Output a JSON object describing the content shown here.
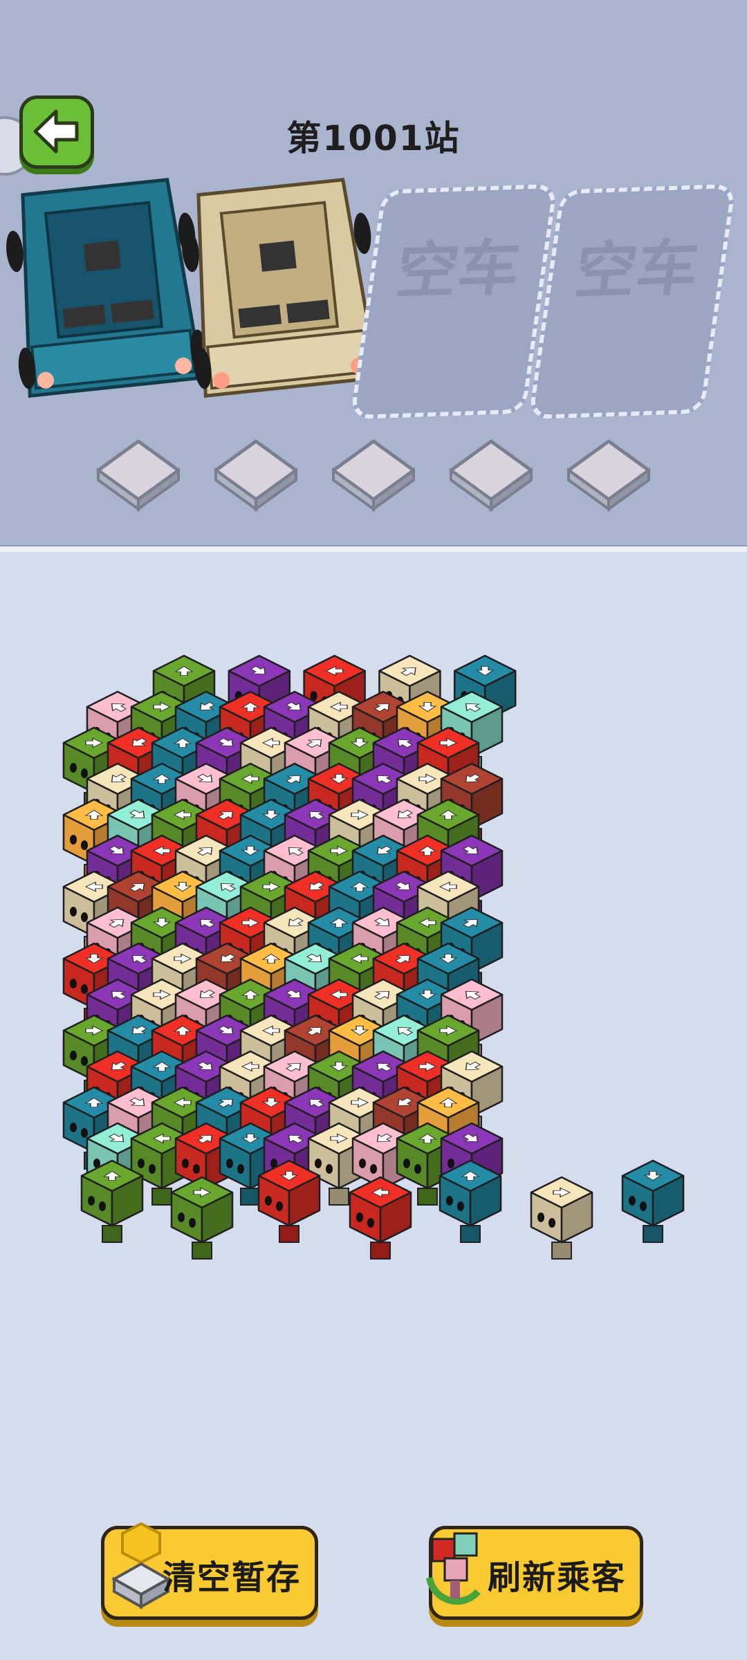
{
  "header": {
    "title": "第1001站"
  },
  "cars": [
    {
      "name": "teal-car",
      "color": "#237891"
    },
    {
      "name": "beige-car",
      "color": "#d9c9a0"
    }
  ],
  "empty_slots": [
    {
      "label": "空车"
    },
    {
      "label": "空车"
    }
  ],
  "holding_pads": 5,
  "colors": {
    "green": "#5c9128",
    "purple": "#7a2fa0",
    "red": "#d12a22",
    "beige": "#d7c7a3",
    "teal": "#1f7a90",
    "pink": "#e6a5b7",
    "brown": "#9a3a2c",
    "orange": "#f1a43d",
    "mint": "#7fcfbb",
    "button_yellow": "#f8c930"
  },
  "buttons": {
    "clear": "清空暂存",
    "refresh": "刷新乘客"
  }
}
